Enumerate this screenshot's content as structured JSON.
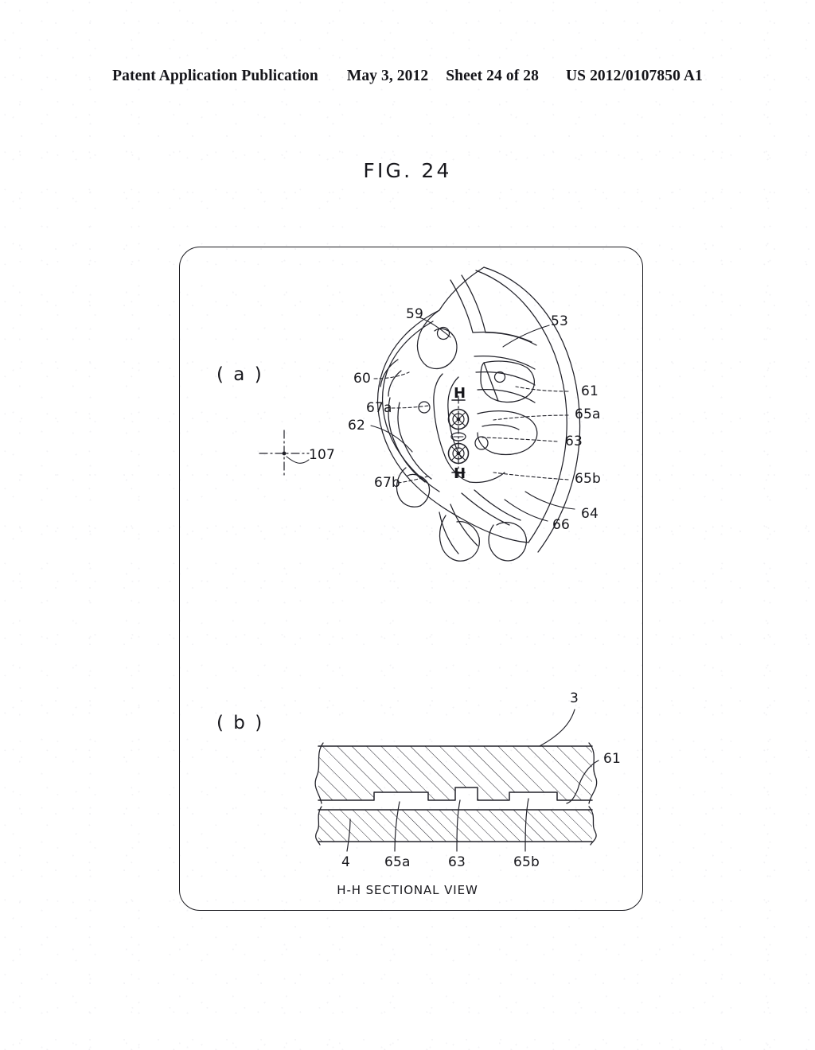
{
  "header": {
    "publication": "Patent Application Publication",
    "date": "May 3, 2012",
    "sheet": "Sheet 24 of 28",
    "doc_number": "US 2012/0107850 A1"
  },
  "figure": {
    "title": "FIG. 24",
    "sectional_caption": "H-H SECTIONAL VIEW"
  },
  "part_a": {
    "label": "( a )",
    "section_mark_top": "H",
    "section_mark_bottom": "H",
    "center_mark_ref": "107",
    "refs": {
      "r59": "59",
      "r53": "53",
      "r60": "60",
      "r61": "61",
      "r67a": "67a",
      "r65a": "65a",
      "r62": "62",
      "r63": "63",
      "r67b": "67b",
      "r65b": "65b",
      "r66": "66",
      "r64": "64"
    }
  },
  "part_b": {
    "label": "( b )",
    "refs": {
      "r3": "3",
      "r61": "61",
      "r4": "4",
      "r65a": "65a",
      "r63": "63",
      "r65b": "65b"
    }
  },
  "colors": {
    "ink": "#17171c",
    "paper": "#ffffff",
    "line": "#1b1b20"
  }
}
